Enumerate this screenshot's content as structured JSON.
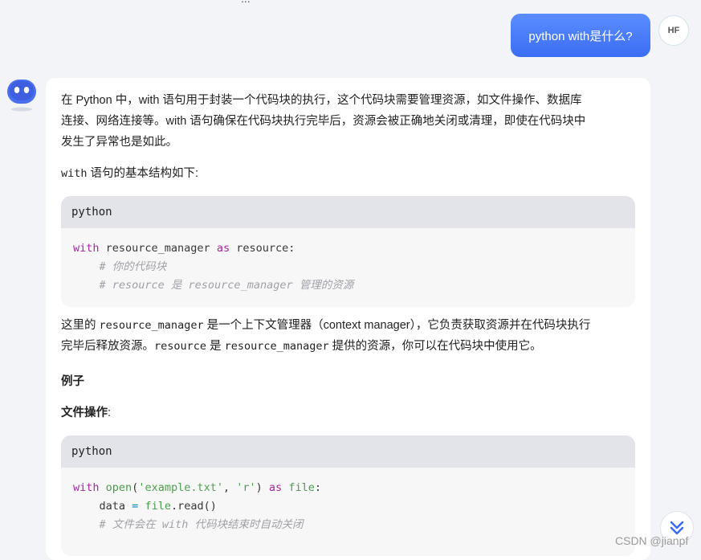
{
  "conversation": {
    "user_message": "python with是什么?",
    "user_avatar_initials": "HF",
    "answer": {
      "intro_line1": "在 Python 中，with 语句用于封装一个代码块的执行，这个代码块需要管理资源，如文件操作、数据库",
      "intro_line2": "连接、网络连接等。with 语句确保在代码块执行完毕后，资源会被正确地关闭或清理，即使在代码块中",
      "intro_line3": "发生了异常也是如此。",
      "structure_label_code": "with",
      "structure_label_text": " 语句的基本结构如下:",
      "code1": {
        "language": "python",
        "line1_kw": "with",
        "line1_mid": " resource_manager ",
        "line1_as": "as",
        "line1_end": " resource:",
        "line2_comment": "    # 你的代码块",
        "line3_comment": "    # resource 是 resource_manager 管理的资源"
      },
      "explain": {
        "p1": "这里的 ",
        "c1": "resource_manager",
        "p2": " 是一个上下文管理器（context manager），它负责获取资源并在代码块执行",
        "p3": "完毕后释放资源。",
        "c2": "resource",
        "p4": " 是 ",
        "c3": "resource_manager",
        "p5": " 提供的资源，你可以在代码块中使用它。"
      },
      "example_heading": "例子",
      "file_ops_heading": "文件操作",
      "file_ops_colon": ":",
      "code2": {
        "language": "python",
        "line1_kw": "with",
        "line1_sp": " ",
        "line1_open": "open",
        "line1_p1": "(",
        "line1_s1": "'example.txt'",
        "line1_comma": ", ",
        "line1_s2": "'r'",
        "line1_p2": ") ",
        "line1_as": "as",
        "line1_sp2": " ",
        "line1_file": "file",
        "line1_colon": ":",
        "line2_a": "    data ",
        "line2_eq": "=",
        "line2_sp": " ",
        "line2_file": "file",
        "line2_b": ".read()",
        "line3_comment": "    # 文件会在 with 代码块结束时自动关闭"
      }
    }
  },
  "watermark": "CSDN @jianpf",
  "icons": {
    "bot": "robot-avatar-icon",
    "scroll": "double-chevron-down-icon"
  },
  "colors": {
    "user_bubble": "#3b6df4",
    "keyword": "#a626a4",
    "string": "#50a14f",
    "comment": "#a0a1a7"
  }
}
